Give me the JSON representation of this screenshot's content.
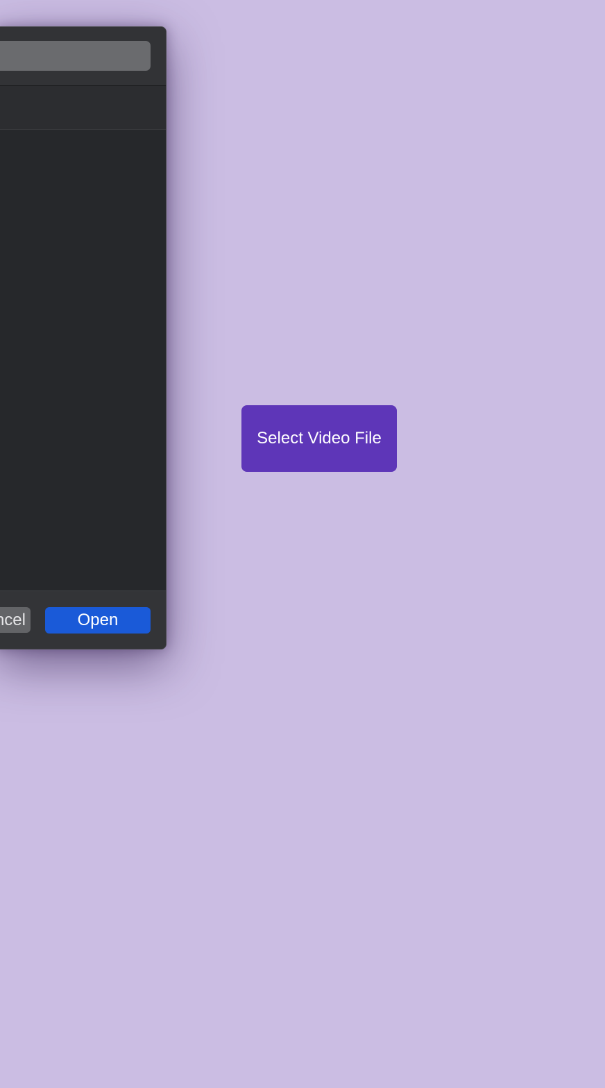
{
  "file_dialog": {
    "search_value": "",
    "cancel_label": "Cancel",
    "open_label": "Open"
  },
  "page": {
    "select_button_label": "Select Video File"
  },
  "colors": {
    "background": "#cbbde3",
    "dialog_bg": "#242527",
    "open_button": "#1a5ad8",
    "select_button": "#5e36b8"
  }
}
